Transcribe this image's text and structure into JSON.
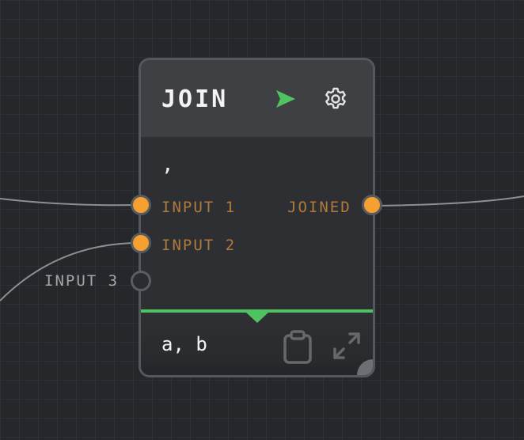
{
  "node": {
    "title": "JOIN",
    "separator": ",",
    "inputs": [
      {
        "label": "INPUT 1",
        "connected": true
      },
      {
        "label": "INPUT 2",
        "connected": true
      },
      {
        "label": "INPUT 3",
        "connected": false
      }
    ],
    "output": {
      "label": "JOINED",
      "connected": true
    },
    "result": "a, b",
    "icons": {
      "run": "send-arrow-icon",
      "settings": "gear-icon",
      "copy": "clipboard-icon",
      "expand": "expand-icon"
    }
  },
  "colors": {
    "port_connected": "#f5a031",
    "accent_green": "#4ec460",
    "label_orange": "#b07a3c",
    "canvas": "#25272b"
  }
}
